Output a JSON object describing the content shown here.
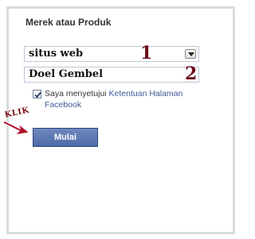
{
  "form": {
    "heading": "Merek atau Produk",
    "category_select": {
      "value": "situs web"
    },
    "name_input": {
      "value": "Doel Gembel"
    },
    "agree": {
      "checked": true,
      "text_prefix": "Saya menyetujui ",
      "link_label": "Ketentuan Halaman Facebook"
    },
    "submit_label": "Mulai"
  },
  "annotations": {
    "step1": "1",
    "step2": "2",
    "klik": "KLIK"
  },
  "colors": {
    "button_bg": "#5b74ad",
    "link": "#3b5998",
    "annotation": "#6b0f1a"
  }
}
